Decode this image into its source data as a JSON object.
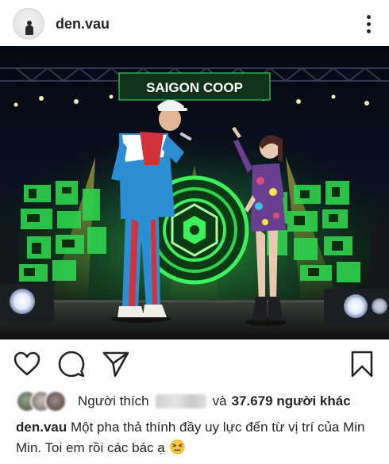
{
  "post": {
    "username": "den.vau",
    "more_icon": "more-vertical-icon"
  },
  "photo": {
    "banner_text": "SAIGON COOP",
    "colors": {
      "stage_green": "#3bf05a",
      "stage_yellow": "#f5e44a",
      "jacket_blue": "#2c8fd6",
      "jacket_red": "#d0343a",
      "dress_purple": "#6b3f8f"
    }
  },
  "actions": {
    "like_icon": "heart-icon",
    "comment_icon": "comment-icon",
    "share_icon": "send-icon",
    "save_icon": "bookmark-icon"
  },
  "likes": {
    "prefix": "Người thích",
    "blurred_name": "lee_.us",
    "connector": "và",
    "count_text": "37.679 người khác"
  },
  "caption": {
    "username": "den.vau",
    "text": "Một pha thả thính đầy uy lực đến từ vị trí của Min Min. Toi em rồi các bác ạ",
    "emoji": "persevering-face-emoji"
  },
  "colors": {
    "text": "#262626",
    "background": "#ffffff"
  }
}
